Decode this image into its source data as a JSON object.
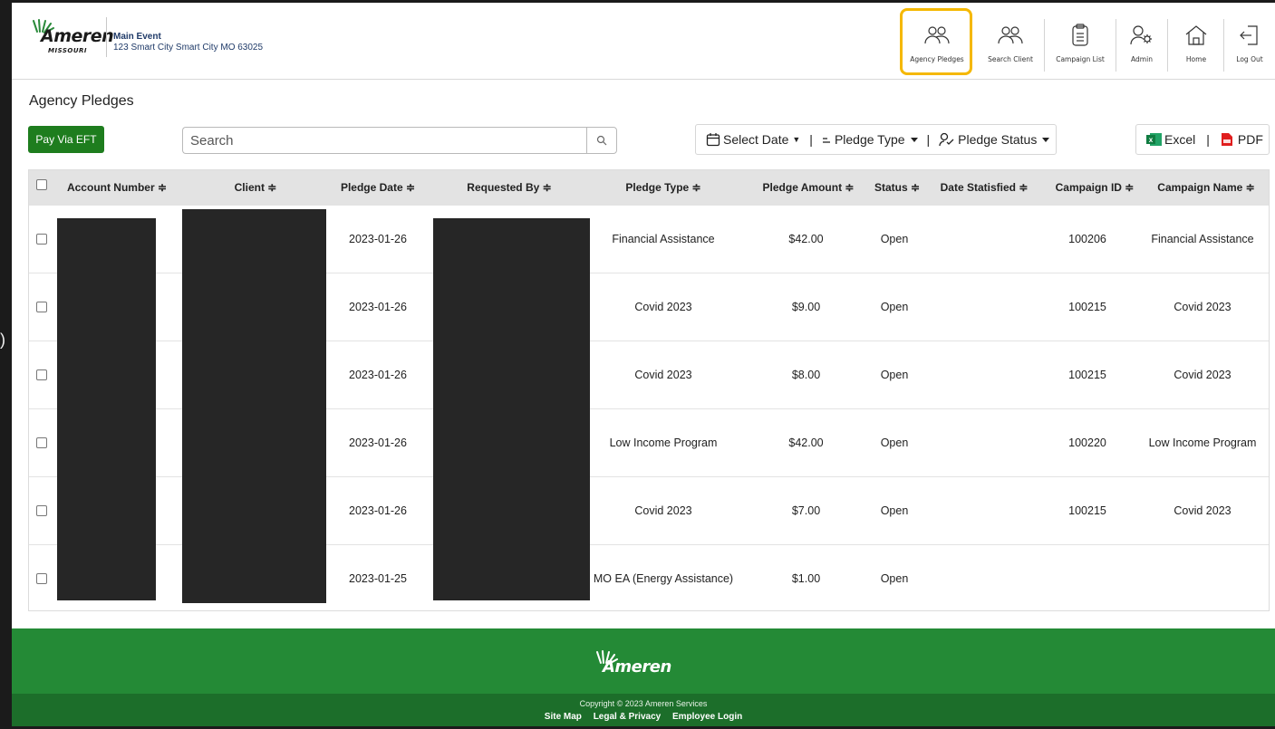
{
  "header": {
    "logo_word": "Ameren",
    "logo_sub": "MISSOURI",
    "event_name": "Main Event",
    "event_address": "123 Smart City Smart City MO 63025",
    "nav": [
      {
        "label": "Agency Pledges",
        "icon": "users-icon",
        "active": true
      },
      {
        "label": "Search Client",
        "icon": "users-icon"
      },
      {
        "label": "Campaign List",
        "icon": "clipboard-icon"
      },
      {
        "label": "Admin",
        "icon": "user-gear-icon"
      },
      {
        "label": "Home",
        "icon": "home-icon"
      },
      {
        "label": "Log Out",
        "icon": "logout-icon"
      }
    ],
    "active_highlight_color": "#f5b800"
  },
  "page": {
    "title": "Agency Pledges"
  },
  "toolbar": {
    "eft_label": "Pay Via EFT",
    "search_placeholder": "Search",
    "filters": {
      "date": "Select Date",
      "pledge_type": "Pledge Type",
      "pledge_status": "Pledge Status",
      "separator": "|"
    },
    "export": {
      "excel": "Excel",
      "separator": "|",
      "pdf": "PDF"
    },
    "eft_color": "#1e7d1e"
  },
  "table": {
    "columns": {
      "account_number": "Account Number ≑",
      "client": "Client ≑",
      "pledge_date": "Pledge Date ≑",
      "requested_by": "Requested By ≑",
      "pledge_type": "Pledge Type ≑",
      "pledge_amount": "Pledge Amount ≑",
      "status": "Status ≑",
      "date_satisfied": "Date Statisfied ≑",
      "campaign_id": "Campaign ID ≑",
      "campaign_name": "Campaign Name ≑"
    },
    "rows": [
      {
        "pledge_date": "2023-01-26",
        "pledge_type": "Financial Assistance",
        "amount": "$42.00",
        "status": "Open",
        "date_satisfied": "",
        "campaign_id": "100206",
        "campaign_name": "Financial Assistance"
      },
      {
        "pledge_date": "2023-01-26",
        "pledge_type": "Covid 2023",
        "amount": "$9.00",
        "status": "Open",
        "date_satisfied": "",
        "campaign_id": "100215",
        "campaign_name": "Covid 2023"
      },
      {
        "pledge_date": "2023-01-26",
        "pledge_type": "Covid 2023",
        "amount": "$8.00",
        "status": "Open",
        "date_satisfied": "",
        "campaign_id": "100215",
        "campaign_name": "Covid 2023"
      },
      {
        "pledge_date": "2023-01-26",
        "pledge_type": "Low Income Program",
        "amount": "$42.00",
        "status": "Open",
        "date_satisfied": "",
        "campaign_id": "100220",
        "campaign_name": "Low Income Program"
      },
      {
        "pledge_date": "2023-01-26",
        "pledge_type": "Covid 2023",
        "amount": "$7.00",
        "status": "Open",
        "date_satisfied": "",
        "campaign_id": "100215",
        "campaign_name": "Covid 2023"
      },
      {
        "pledge_date": "2023-01-25",
        "pledge_type": "MO EA (Energy Assistance)",
        "amount": "$1.00",
        "status": "Open",
        "date_satisfied": "",
        "campaign_id": "",
        "campaign_name": ""
      }
    ]
  },
  "footer": {
    "logo_word": "Ameren",
    "copyright": "Copyright © 2023 Ameren Services",
    "links": [
      "Site Map",
      "Legal & Privacy",
      "Employee Login"
    ],
    "brand_color": "#248a36"
  }
}
